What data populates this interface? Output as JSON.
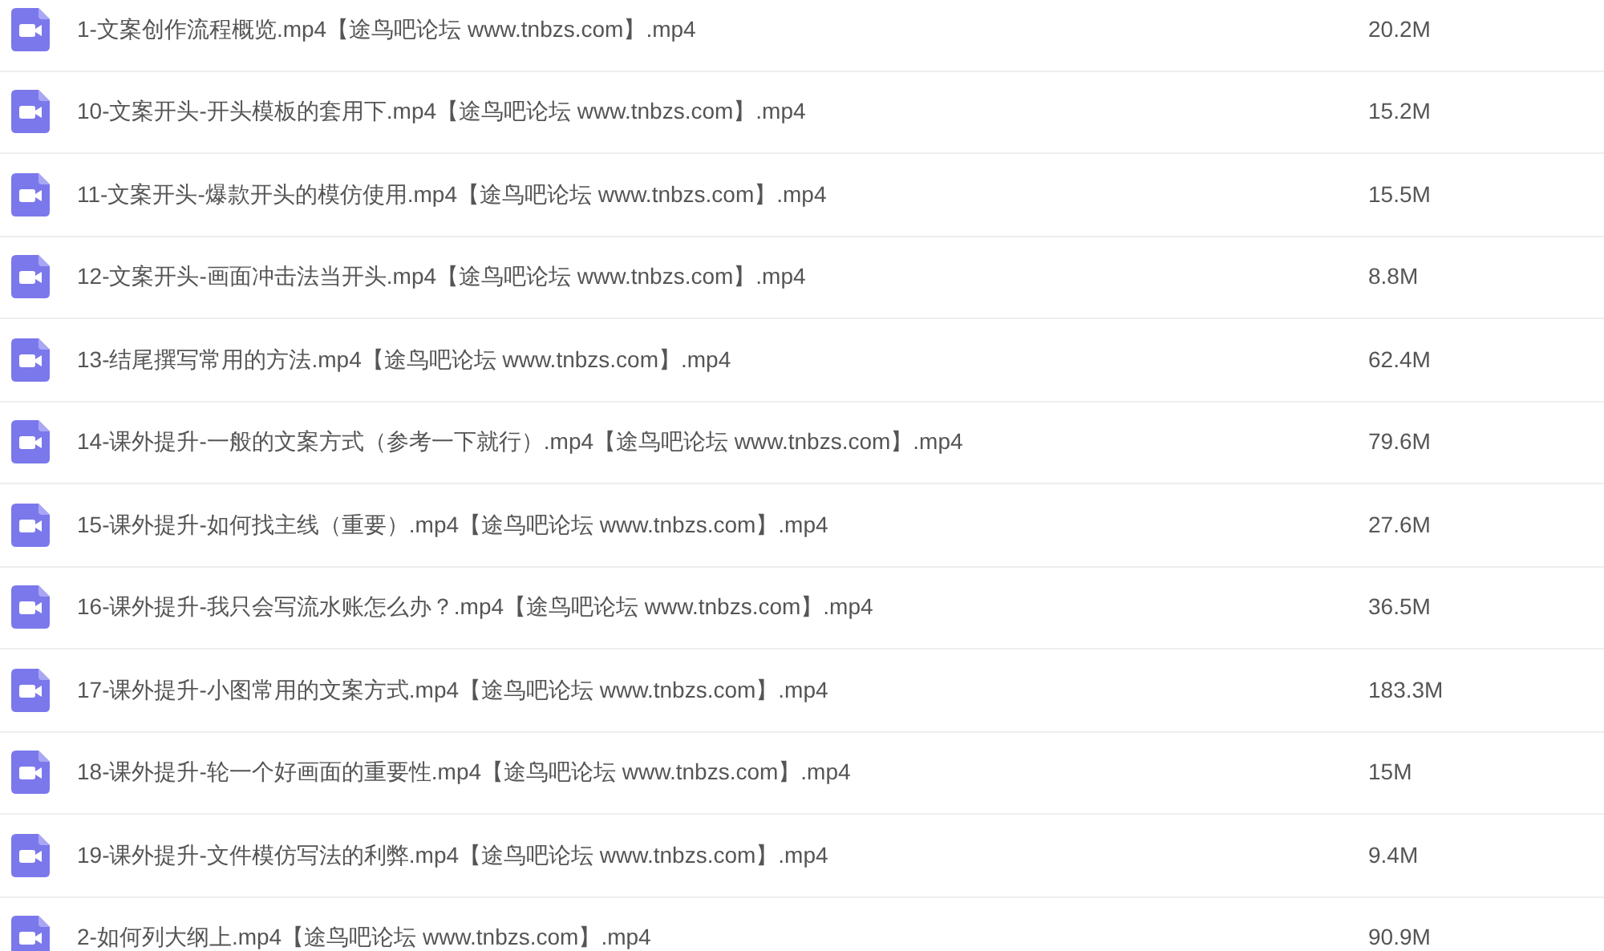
{
  "files": [
    {
      "name": "1-文案创作流程概览.mp4【途鸟吧论坛 www.tnbzs.com】.mp4",
      "size": "20.2M"
    },
    {
      "name": "10-文案开头-开头模板的套用下.mp4【途鸟吧论坛 www.tnbzs.com】.mp4",
      "size": "15.2M"
    },
    {
      "name": "11-文案开头-爆款开头的模仿使用.mp4【途鸟吧论坛 www.tnbzs.com】.mp4",
      "size": "15.5M"
    },
    {
      "name": "12-文案开头-画面冲击法当开头.mp4【途鸟吧论坛 www.tnbzs.com】.mp4",
      "size": "8.8M"
    },
    {
      "name": "13-结尾撰写常用的方法.mp4【途鸟吧论坛 www.tnbzs.com】.mp4",
      "size": "62.4M"
    },
    {
      "name": "14-课外提升-一般的文案方式（参考一下就行）.mp4【途鸟吧论坛 www.tnbzs.com】.mp4",
      "size": "79.6M"
    },
    {
      "name": "15-课外提升-如何找主线（重要）.mp4【途鸟吧论坛 www.tnbzs.com】.mp4",
      "size": "27.6M"
    },
    {
      "name": "16-课外提升-我只会写流水账怎么办？.mp4【途鸟吧论坛 www.tnbzs.com】.mp4",
      "size": "36.5M"
    },
    {
      "name": "17-课外提升-小图常用的文案方式.mp4【途鸟吧论坛 www.tnbzs.com】.mp4",
      "size": "183.3M"
    },
    {
      "name": "18-课外提升-轮一个好画面的重要性.mp4【途鸟吧论坛 www.tnbzs.com】.mp4",
      "size": "15M"
    },
    {
      "name": "19-课外提升-文件模仿写法的利弊.mp4【途鸟吧论坛 www.tnbzs.com】.mp4",
      "size": "9.4M"
    },
    {
      "name": "2-如何列大纲上.mp4【途鸟吧论坛 www.tnbzs.com】.mp4",
      "size": "90.9M"
    }
  ]
}
